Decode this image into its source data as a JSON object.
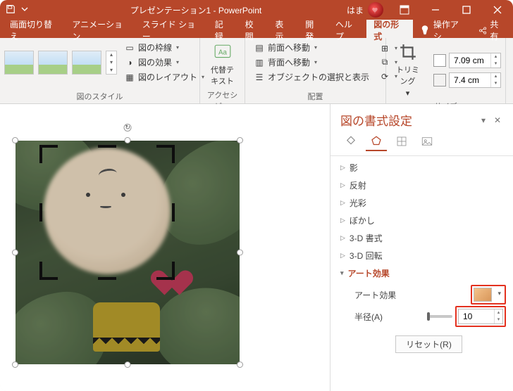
{
  "titlebar": {
    "title": "プレゼンテーション1 - PowerPoint",
    "user": "はま"
  },
  "tabs": {
    "items": [
      "画面切り替え",
      "アニメーション",
      "スライド ショー",
      "記録",
      "校閲",
      "表示",
      "開発",
      "ヘルプ",
      "図の形式"
    ],
    "operate": "操作アシ",
    "share": "共有"
  },
  "ribbon": {
    "style": {
      "border": "図の枠線",
      "effect": "図の効果",
      "layout": "図のレイアウト",
      "group": "図のスタイル"
    },
    "access": {
      "alt": "代替テキスト",
      "group": "アクセシビ…"
    },
    "arrange": {
      "front": "前面へ移動",
      "back": "背面へ移動",
      "select": "オブジェクトの選択と表示",
      "group": "配置"
    },
    "size": {
      "trim": "トリミング",
      "h": "7.09 cm",
      "w": "7.4 cm",
      "group": "サイズ"
    }
  },
  "pane": {
    "title": "図の書式設定",
    "sections": {
      "shadow": "影",
      "reflect": "反射",
      "glow": "光彩",
      "blur": "ぼかし",
      "fmt3d": "3-D 書式",
      "rot3d": "3-D 回転",
      "art": "アート効果"
    },
    "art": {
      "label": "アート効果",
      "radius": "半径(A)",
      "radius_val": "10",
      "reset": "リセット(R)"
    }
  }
}
